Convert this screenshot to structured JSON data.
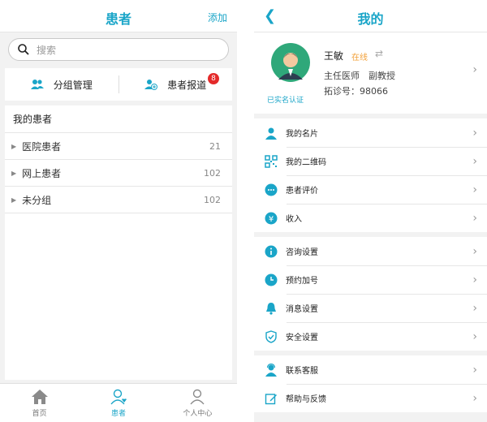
{
  "left": {
    "title": "患者",
    "add_label": "添加",
    "search_placeholder": "搜索",
    "group_manage": "分组管理",
    "patient_report": "患者报道",
    "report_badge": "8",
    "my_patients": "我的患者",
    "groups": [
      {
        "label": "医院患者",
        "count": "21"
      },
      {
        "label": "网上患者",
        "count": "102"
      },
      {
        "label": "未分组",
        "count": "102"
      }
    ],
    "tabs": [
      {
        "label": "首页",
        "icon": "home-icon"
      },
      {
        "label": "患者",
        "icon": "patient-icon"
      },
      {
        "label": "个人中心",
        "icon": "user-icon"
      }
    ]
  },
  "right": {
    "title": "我的",
    "back_icon": "back-icon",
    "profile": {
      "name": "王敏",
      "status": "在线",
      "title": "主任医师　副教授",
      "id_line": "拓诊号：98066",
      "verified": "已实名认证"
    },
    "menu_group1": [
      "我的名片",
      "我的二维码",
      "患者评价",
      "收入"
    ],
    "menu_group2": [
      "咨询设置",
      "预约加号",
      "消息设置",
      "安全设置"
    ],
    "menu_group3": [
      "联系客服",
      "帮助与反馈"
    ]
  },
  "colors": {
    "accent": "#1aa5c8",
    "online": "#f2a13a",
    "badge": "#e42a2a"
  }
}
